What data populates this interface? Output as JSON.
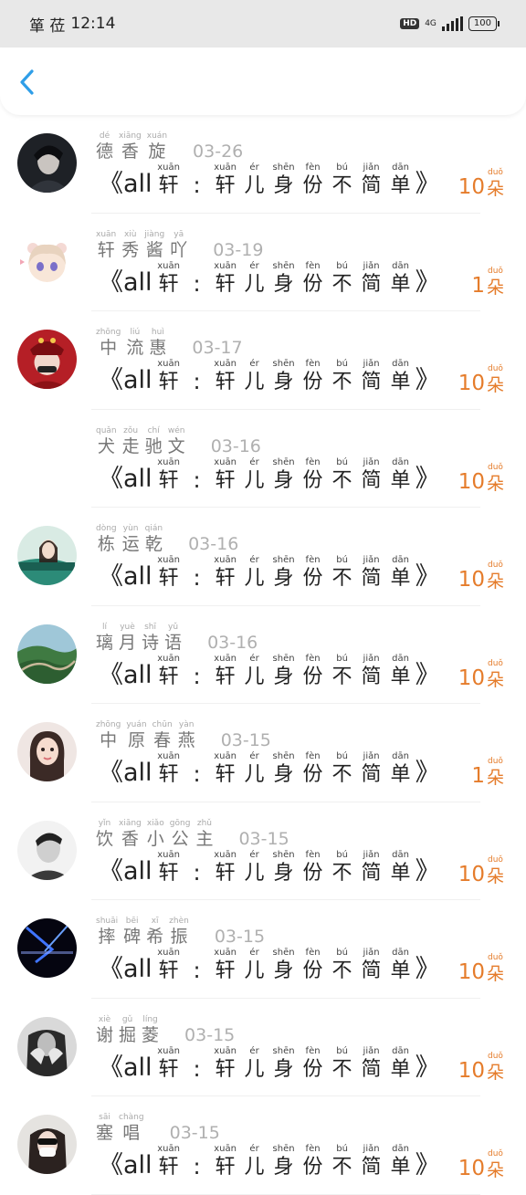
{
  "status_bar": {
    "carrier": "箪 莅",
    "time": "12:14",
    "hd": "HD",
    "network": "4G",
    "battery": "100"
  },
  "title_chars": [
    {
      "py": "xuān",
      "hz": "轩"
    },
    {
      "py": "",
      "hz": ":"
    },
    {
      "py": "xuān",
      "hz": "轩"
    },
    {
      "py": "ér",
      "hz": "儿"
    },
    {
      "py": "shēn",
      "hz": "身"
    },
    {
      "py": "fèn",
      "hz": "份"
    },
    {
      "py": "bú",
      "hz": "不"
    },
    {
      "py": "jiǎn",
      "hz": "简"
    },
    {
      "py": "dān",
      "hz": "单"
    }
  ],
  "title": {
    "open": "《",
    "all": "all",
    "close": "》"
  },
  "unit": {
    "py": "duǒ",
    "hz": "朵"
  },
  "rows": [
    {
      "name": [
        {
          "py": "dé",
          "hz": "德"
        },
        {
          "py": "xiāng",
          "hz": "香"
        },
        {
          "py": "xuán",
          "hz": "旋"
        }
      ],
      "date": "03-26",
      "count": "10",
      "avatar": "dark-portrait"
    },
    {
      "name": [
        {
          "py": "xuān",
          "hz": "轩"
        },
        {
          "py": "xiù",
          "hz": "秀"
        },
        {
          "py": "jiàng",
          "hz": "酱"
        },
        {
          "py": "yā",
          "hz": "吖"
        }
      ],
      "date": "03-19",
      "count": "1",
      "avatar": "anime-girl"
    },
    {
      "name": [
        {
          "py": "zhōng",
          "hz": "中"
        },
        {
          "py": "liú",
          "hz": "流"
        },
        {
          "py": "huì",
          "hz": "惠"
        }
      ],
      "date": "03-17",
      "count": "10",
      "avatar": "red-costume"
    },
    {
      "name": [
        {
          "py": "quǎn",
          "hz": "犬"
        },
        {
          "py": "zǒu",
          "hz": "走"
        },
        {
          "py": "chí",
          "hz": "驰"
        },
        {
          "py": "wén",
          "hz": "文"
        }
      ],
      "date": "03-16",
      "count": "10",
      "avatar": "none"
    },
    {
      "name": [
        {
          "py": "dòng",
          "hz": "栋"
        },
        {
          "py": "yùn",
          "hz": "运"
        },
        {
          "py": "qián",
          "hz": "乾"
        }
      ],
      "date": "03-16",
      "count": "10",
      "avatar": "teal-girl"
    },
    {
      "name": [
        {
          "py": "lí",
          "hz": "璃"
        },
        {
          "py": "yuè",
          "hz": "月"
        },
        {
          "py": "shī",
          "hz": "诗"
        },
        {
          "py": "yǔ",
          "hz": "语"
        }
      ],
      "date": "03-16",
      "count": "10",
      "avatar": "great-wall"
    },
    {
      "name": [
        {
          "py": "zhōng",
          "hz": "中"
        },
        {
          "py": "yuán",
          "hz": "原"
        },
        {
          "py": "chūn",
          "hz": "春"
        },
        {
          "py": "yàn",
          "hz": "燕"
        }
      ],
      "date": "03-15",
      "count": "1",
      "avatar": "girl-selfie"
    },
    {
      "name": [
        {
          "py": "yǐn",
          "hz": "饮"
        },
        {
          "py": "xiāng",
          "hz": "香"
        },
        {
          "py": "xiǎo",
          "hz": "小"
        },
        {
          "py": "gōng",
          "hz": "公"
        },
        {
          "py": "zhǔ",
          "hz": "主"
        }
      ],
      "date": "03-15",
      "count": "10",
      "avatar": "bw-boy"
    },
    {
      "name": [
        {
          "py": "shuāi",
          "hz": "摔"
        },
        {
          "py": "bēi",
          "hz": "碑"
        },
        {
          "py": "xī",
          "hz": "希"
        },
        {
          "py": "zhèn",
          "hz": "振"
        }
      ],
      "date": "03-15",
      "count": "10",
      "avatar": "blue-logo"
    },
    {
      "name": [
        {
          "py": "xiè",
          "hz": "谢"
        },
        {
          "py": "gǔ",
          "hz": "掘"
        },
        {
          "py": "líng",
          "hz": "菱"
        }
      ],
      "date": "03-15",
      "count": "10",
      "avatar": "bw-hands"
    },
    {
      "name": [
        {
          "py": "sāi",
          "hz": "塞"
        },
        {
          "py": "chàng",
          "hz": "唱"
        }
      ],
      "date": "03-15",
      "count": "10",
      "avatar": "mask-girl"
    }
  ],
  "colors": {
    "accent": "#e57c2b",
    "back": "#2f9ee8"
  }
}
